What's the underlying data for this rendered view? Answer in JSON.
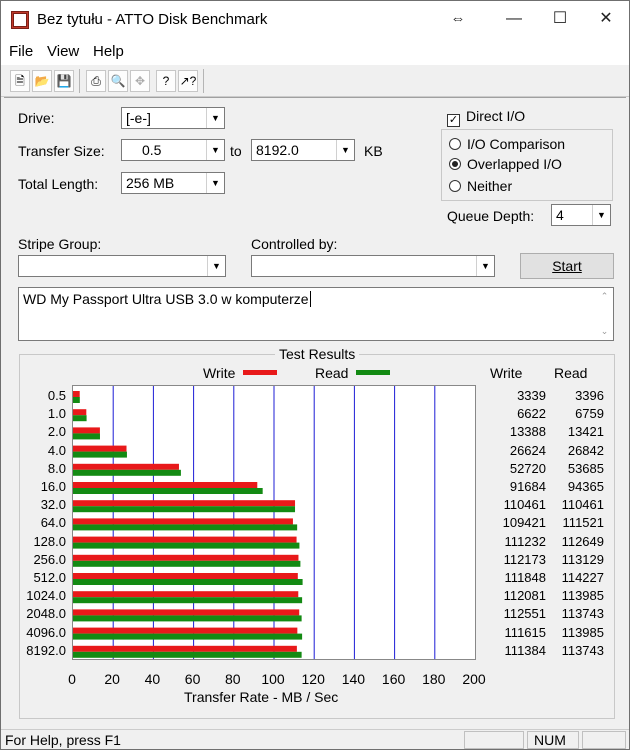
{
  "window": {
    "title": "Bez tytułu - ATTO Disk Benchmark",
    "controls": {
      "resize": "⇔",
      "minimize": "—",
      "maximize": "☐",
      "close": "✕"
    }
  },
  "menu": {
    "file": "File",
    "view": "View",
    "help": "Help"
  },
  "toolbar": {
    "icons": [
      "new-icon",
      "open-icon",
      "save-icon",
      "print-icon",
      "print-preview-icon",
      "move-icon",
      "help-icon",
      "context-help-icon"
    ]
  },
  "form": {
    "drive_label": "Drive:",
    "drive_value": "[-e-]",
    "transfer_label": "Transfer Size:",
    "transfer_from": "0.5",
    "to_label": "to",
    "transfer_to": "8192.0",
    "kb_label": "KB",
    "total_length_label": "Total Length:",
    "total_length_value": "256 MB",
    "direct_io_label": "Direct I/O",
    "direct_io_checked": true,
    "io_comparison_label": "I/O Comparison",
    "overlapped_io_label": "Overlapped I/O",
    "neither_label": "Neither",
    "selected_mode": "overlapped",
    "queue_depth_label": "Queue Depth:",
    "queue_depth_value": "4",
    "stripe_group_label": "Stripe Group:",
    "stripe_group_value": "",
    "controlled_by_label": "Controlled by:",
    "controlled_by_value": "",
    "start_label": "Start",
    "description": "WD My Passport Ultra USB 3.0 w komputerze"
  },
  "results": {
    "title": "Test Results",
    "legend_write": "Write",
    "legend_read": "Read",
    "col_write": "Write",
    "col_read": "Read",
    "x_axis_label": "Transfer Rate - MB / Sec",
    "colors": {
      "write": "#e8191a",
      "read": "#138a13",
      "grid": "#1c1cd6"
    }
  },
  "chart_data": {
    "type": "bar",
    "orientation": "horizontal",
    "categories": [
      "0.5",
      "1.0",
      "2.0",
      "4.0",
      "8.0",
      "16.0",
      "32.0",
      "64.0",
      "128.0",
      "256.0",
      "512.0",
      "1024.0",
      "2048.0",
      "4096.0",
      "8192.0"
    ],
    "series": [
      {
        "name": "Write",
        "values": [
          3339,
          6622,
          13388,
          26624,
          52720,
          91684,
          110461,
          109421,
          111232,
          112173,
          111848,
          112081,
          112551,
          111615,
          111384
        ]
      },
      {
        "name": "Read",
        "values": [
          3396,
          6759,
          13421,
          26842,
          53685,
          94365,
          110461,
          111521,
          112649,
          113129,
          114227,
          113985,
          113743,
          113985,
          113743
        ]
      }
    ],
    "x_ticks": [
      "0",
      "20",
      "40",
      "60",
      "80",
      "100",
      "120",
      "140",
      "160",
      "180",
      "200"
    ],
    "xlim": [
      0,
      200
    ],
    "xlabel": "Transfer Rate - MB / Sec",
    "grid": true
  },
  "status": {
    "help_text": "For Help, press F1",
    "num": "NUM"
  }
}
